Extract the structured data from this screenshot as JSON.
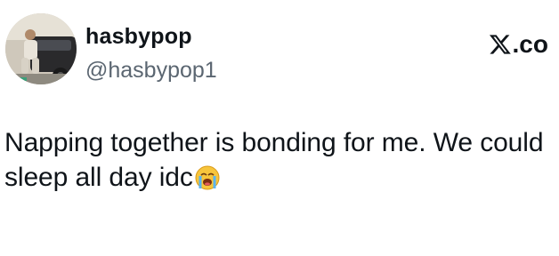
{
  "tweet": {
    "display_name": "hasbypop",
    "handle": "@hasbypop1",
    "source_suffix": ".co",
    "source_icon": "x-logo-icon",
    "text": "Napping together is bonding for me. We could sleep all day idc",
    "emoji": "loudly-crying-face-icon"
  },
  "colors": {
    "text_primary": "#0f1419",
    "text_secondary": "#5b6671",
    "background": "#ffffff"
  }
}
